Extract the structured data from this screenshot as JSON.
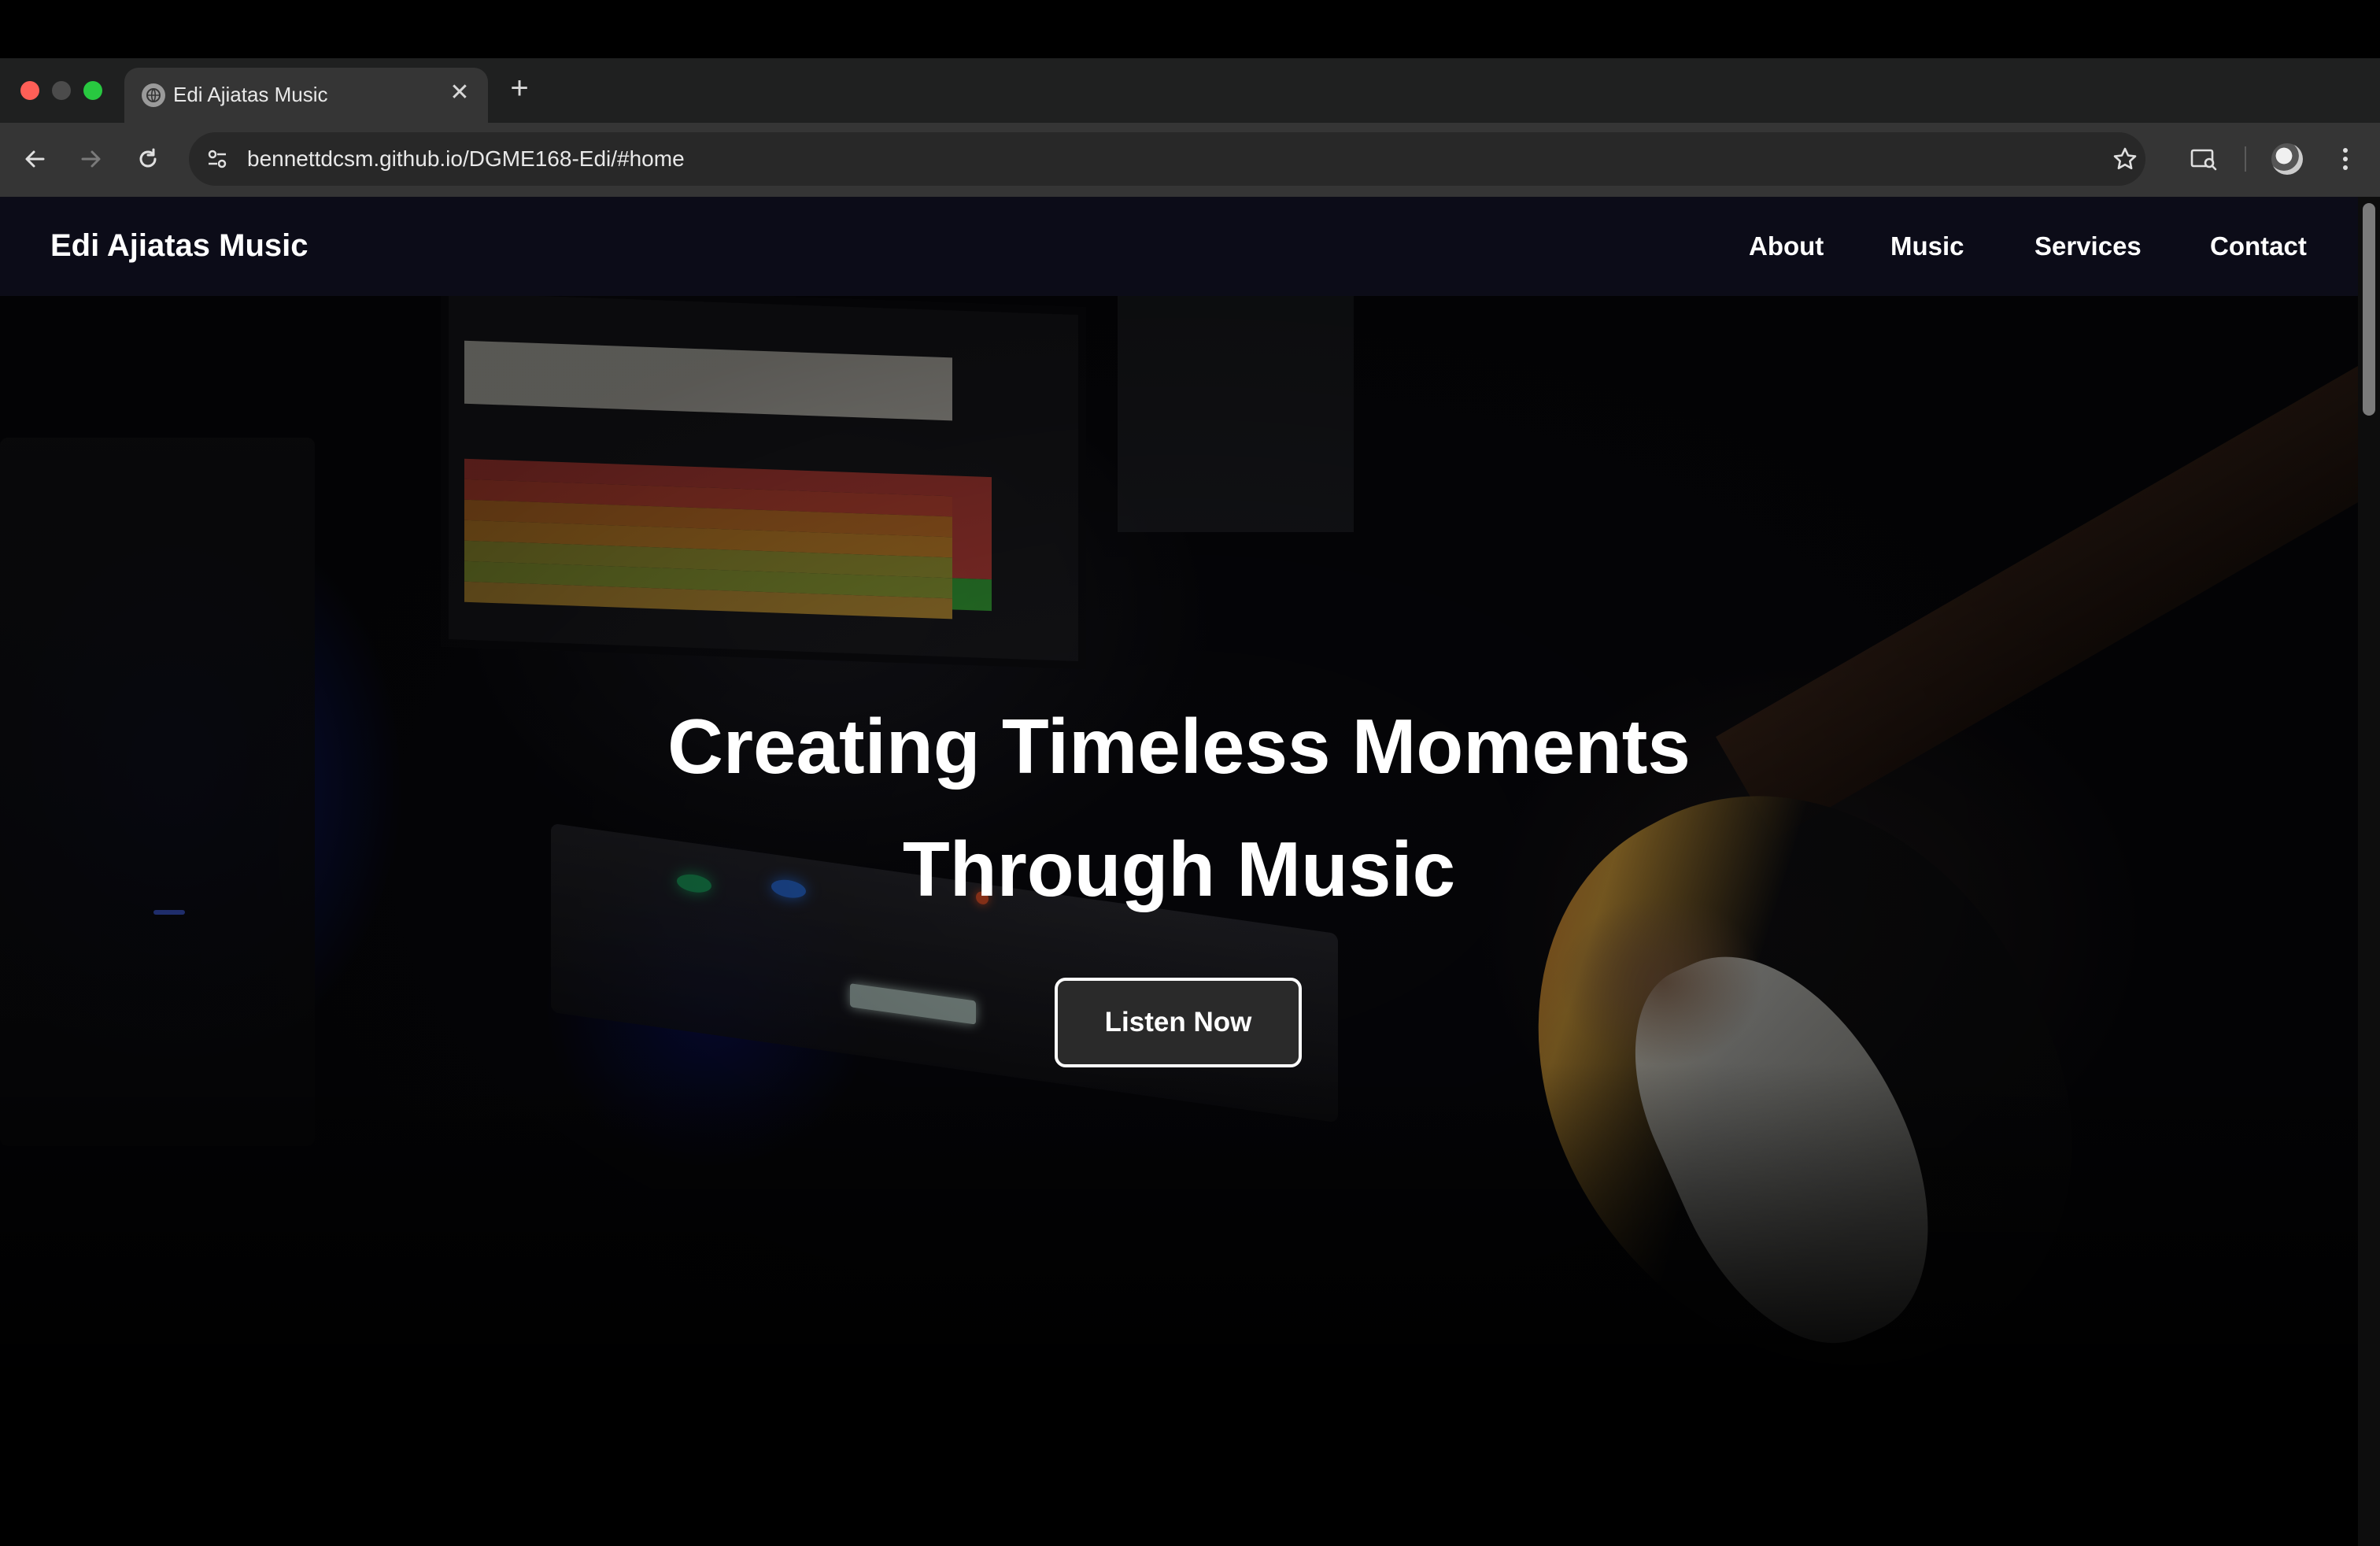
{
  "browser": {
    "tab_title": "Edi Ajiatas Music",
    "close_glyph": "✕",
    "new_tab_glyph": "+",
    "url": "bennettdcsm.github.io/DGME168-Edi/#home"
  },
  "site": {
    "brand": "Edi Ajiatas Music",
    "nav": [
      "About",
      "Music",
      "Services",
      "Contact"
    ]
  },
  "hero": {
    "title_line1": "Creating Timeless Moments",
    "title_line2": "Through Music",
    "cta_label": "Listen Now"
  },
  "icons": {
    "back": "arrow-left-icon",
    "forward": "arrow-right-icon",
    "reload": "reload-icon",
    "site_info": "tune-icon",
    "bookmark": "star-icon",
    "cast": "cast-search-icon",
    "menu": "kebab-menu-icon"
  },
  "colors": {
    "nav_bg": "#0c0c18",
    "cta_bg": "#2a2a2a",
    "text": "#ffffff"
  }
}
